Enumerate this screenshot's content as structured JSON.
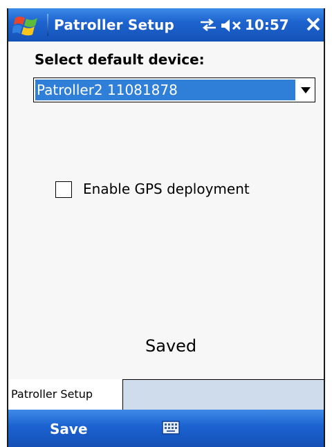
{
  "titlebar": {
    "title": "Patroller Setup",
    "time": "10:57",
    "icons": [
      "windows-start-icon",
      "connectivity-icon",
      "speaker-muted-icon",
      "close-icon"
    ]
  },
  "form": {
    "select_label": "Select default device:",
    "selected_device": "Patroller2 11081878",
    "checkbox_label": "Enable GPS deployment",
    "checkbox_checked": false,
    "status": "Saved"
  },
  "tabs": [
    {
      "label": "Patroller Setup",
      "active": true
    }
  ],
  "menubar": {
    "left_softkey": "Save",
    "center_icon": "keyboard-icon"
  },
  "colors": {
    "titlebar_blue": "#1e64cf",
    "selection_blue": "#2f7fd8",
    "tabstrip": "#cfdcec"
  }
}
